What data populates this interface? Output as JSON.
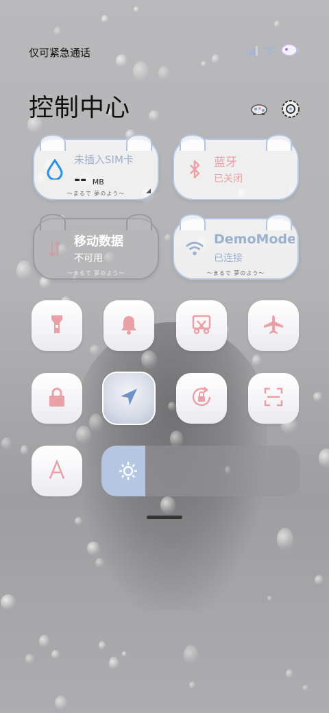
{
  "status_bar": {
    "carrier_text": "仅可紧急通话"
  },
  "page_title": "控制中心",
  "cards": {
    "data_usage": {
      "label": "未插入SIM卡",
      "value": "--",
      "unit": "MB",
      "deco": "～まるで 夢のよう～"
    },
    "bluetooth": {
      "label": "蓝牙",
      "status": "已关闭",
      "deco": "～まるで 夢のよう～"
    },
    "mobile_data": {
      "label": "移动数据",
      "status": "不可用",
      "deco": "～まるで 夢のよう～"
    },
    "wifi": {
      "label": "DemoMode",
      "status": "已连接",
      "deco": "～まるで 夢のよう～"
    }
  },
  "tiles": [
    "flashlight",
    "bell",
    "screenshot",
    "airplane",
    "lock",
    "location",
    "rotation-lock",
    "scan",
    "font-size"
  ],
  "brightness": {
    "level": 0.22
  },
  "colors": {
    "accent_blue": "#2c8fe6",
    "tile_icon_pink": "#e9a0a6",
    "card_border": "#b5c6e2",
    "brightness_fill": "#b5c6e2"
  }
}
